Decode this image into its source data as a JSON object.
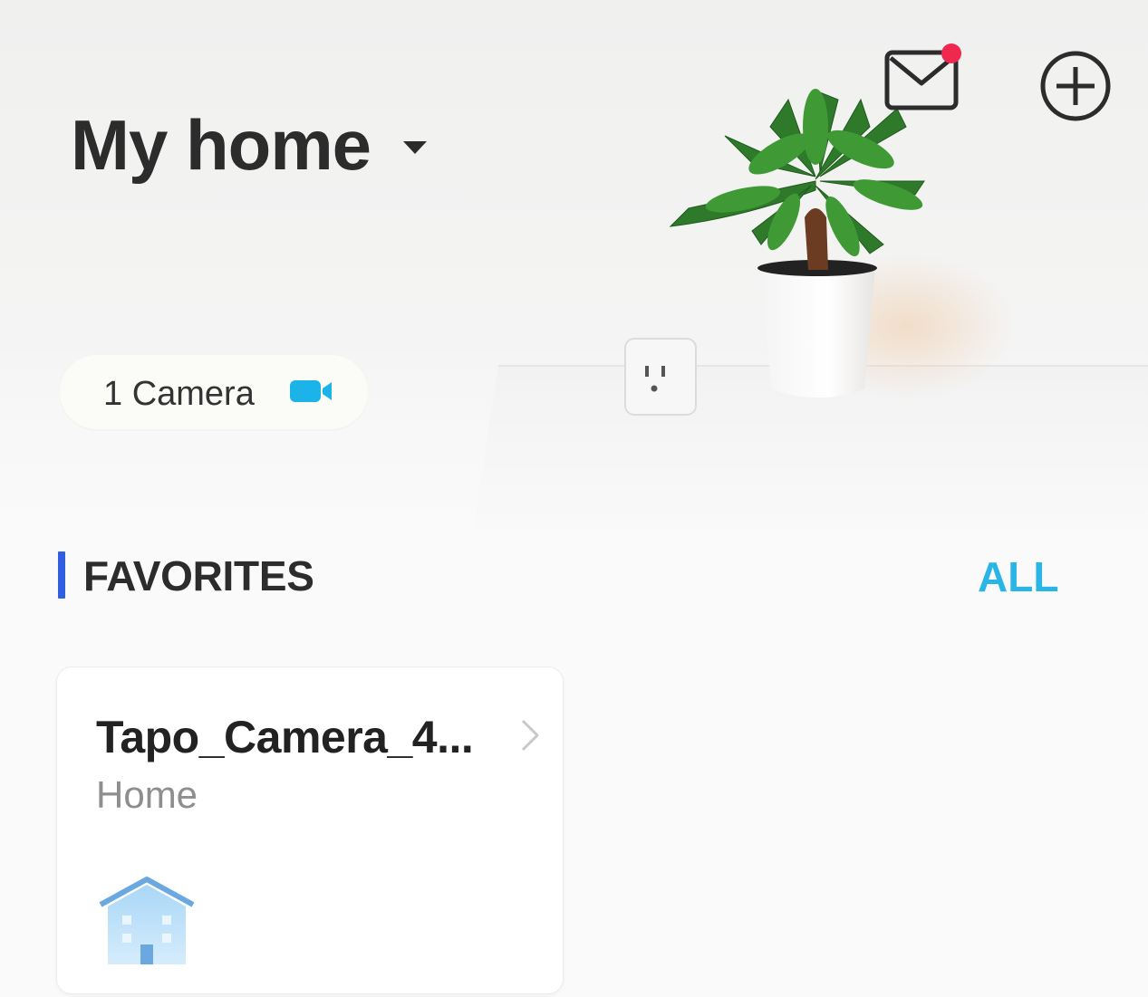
{
  "header": {
    "title": "My home",
    "notification_badge_color": "#f0284f"
  },
  "camera_chip": {
    "label": "1 Camera",
    "icon": "video-camera-icon",
    "icon_color": "#1cb3e8"
  },
  "favorites": {
    "title": "FAVORITES",
    "all_label": "ALL",
    "accent_color": "#2f5fe0",
    "all_color": "#29b6e6"
  },
  "devices": [
    {
      "name": "Tapo_Camera_4...",
      "location": "Home",
      "icon": "house-icon"
    }
  ]
}
